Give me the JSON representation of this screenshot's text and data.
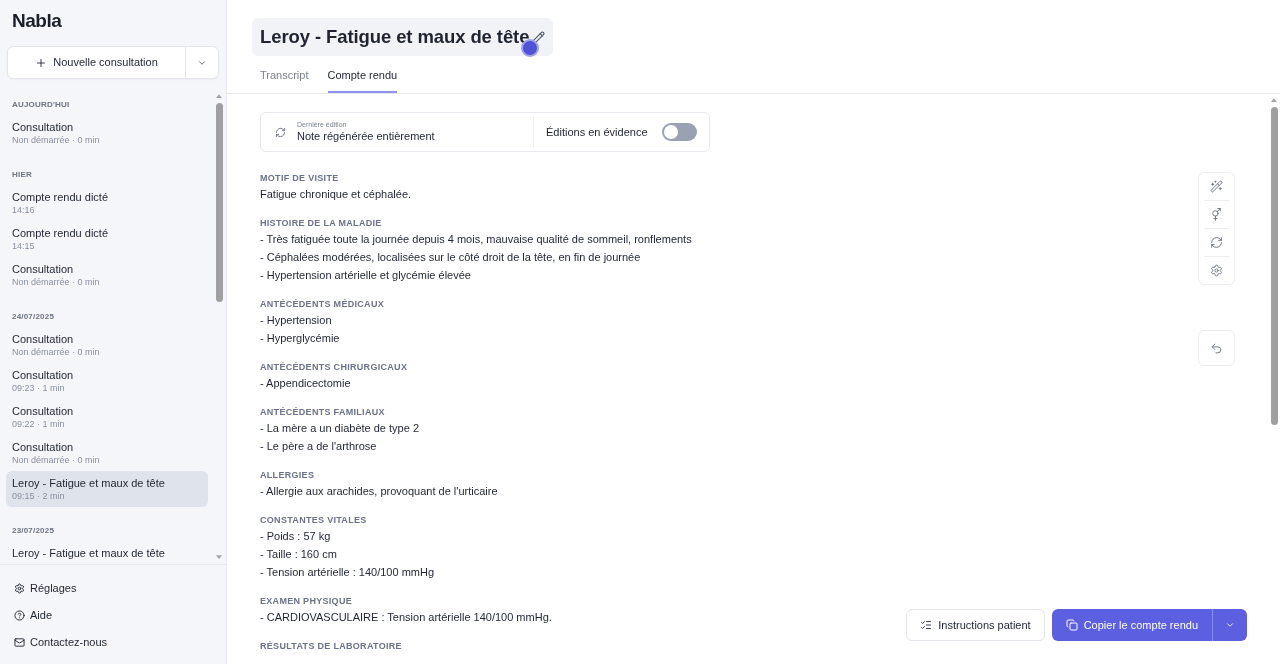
{
  "sidebar": {
    "logo": "Nabla",
    "new_button": {
      "label": "Nouvelle consultation"
    },
    "sections": [
      {
        "heading": "AUJOURD'HUI",
        "items": [
          {
            "title": "Consultation",
            "subtitle": "Non démarrée · 0 min",
            "selected": false
          }
        ]
      },
      {
        "heading": "HIER",
        "items": [
          {
            "title": "Compte rendu dicté",
            "subtitle": "14:16",
            "selected": false
          },
          {
            "title": "Compte rendu dicté",
            "subtitle": "14:15",
            "selected": false
          },
          {
            "title": "Consultation",
            "subtitle": "Non démarrée · 0 min",
            "selected": false
          }
        ]
      },
      {
        "heading": "24/07/2025",
        "items": [
          {
            "title": "Consultation",
            "subtitle": "Non démarrée · 0 min",
            "selected": false
          },
          {
            "title": "Consultation",
            "subtitle": "09:23 · 1 min",
            "selected": false
          },
          {
            "title": "Consultation",
            "subtitle": "09:22 · 1 min",
            "selected": false
          },
          {
            "title": "Consultation",
            "subtitle": "Non démarrée · 0 min",
            "selected": false
          },
          {
            "title": "Leroy - Fatigue et maux de tête",
            "subtitle": "09:15 · 2 min",
            "selected": true
          }
        ]
      },
      {
        "heading": "23/07/2025",
        "items": [
          {
            "title": "Leroy - Fatigue et maux de tête",
            "selected": false
          }
        ]
      }
    ],
    "footer_links": [
      {
        "label": "Réglages"
      },
      {
        "label": "Aide"
      },
      {
        "label": "Contactez-nous"
      }
    ]
  },
  "header": {
    "title": "Leroy - Fatigue et maux de tête"
  },
  "tabs": [
    {
      "label": "Transcript",
      "selected": false
    },
    {
      "label": "Compte rendu",
      "selected": true
    }
  ],
  "edit_card": {
    "caption": "Dernière édition",
    "value": "Note régénérée entièrement",
    "toggle_label": "Éditions en évidence",
    "on": false
  },
  "sections": [
    {
      "heading": "MOTIF DE VISITE",
      "lines": [
        "Fatigue chronique et céphalée."
      ]
    },
    {
      "heading": "HISTOIRE DE LA MALADIE",
      "lines": [
        "- Très fatiguée toute la journée depuis 4 mois, mauvaise qualité de sommeil, ronflements",
        "- Céphalées modérées, localisées sur le côté droit de la tête, en fin de journée",
        "- Hypertension artérielle et glycémie élevée"
      ]
    },
    {
      "heading": "ANTÉCÉDENTS MÉDICAUX",
      "lines": [
        "- Hypertension",
        "- Hyperglycémie"
      ]
    },
    {
      "heading": "ANTÉCÉDENTS CHIRURGICAUX",
      "lines": [
        "- Appendicectomie"
      ]
    },
    {
      "heading": "ANTÉCÉDENTS FAMILIAUX",
      "lines": [
        "- La mère a un diabète de type 2",
        "- Le père a de l'arthrose"
      ]
    },
    {
      "heading": "ALLERGIES",
      "lines": [
        "- Allergie aux arachides, provoquant de l'urticaire"
      ]
    },
    {
      "heading": "CONSTANTES VITALES",
      "lines": [
        "- Poids : 57 kg",
        "- Taille : 160 cm",
        "- Tension artérielle : 140/100 mmHg"
      ]
    },
    {
      "heading": "EXAMEN PHYSIQUE",
      "lines": [
        "- CARDIOVASCULAIRE : Tension artérielle 140/100 mmHg."
      ]
    },
    {
      "heading": "RÉSULTATS DE LABORATOIRE"
    }
  ],
  "actions": [
    {
      "kind": "secondary",
      "label": "Instructions patient"
    },
    {
      "kind": "primary",
      "label": "Copier le compte rendu"
    }
  ]
}
